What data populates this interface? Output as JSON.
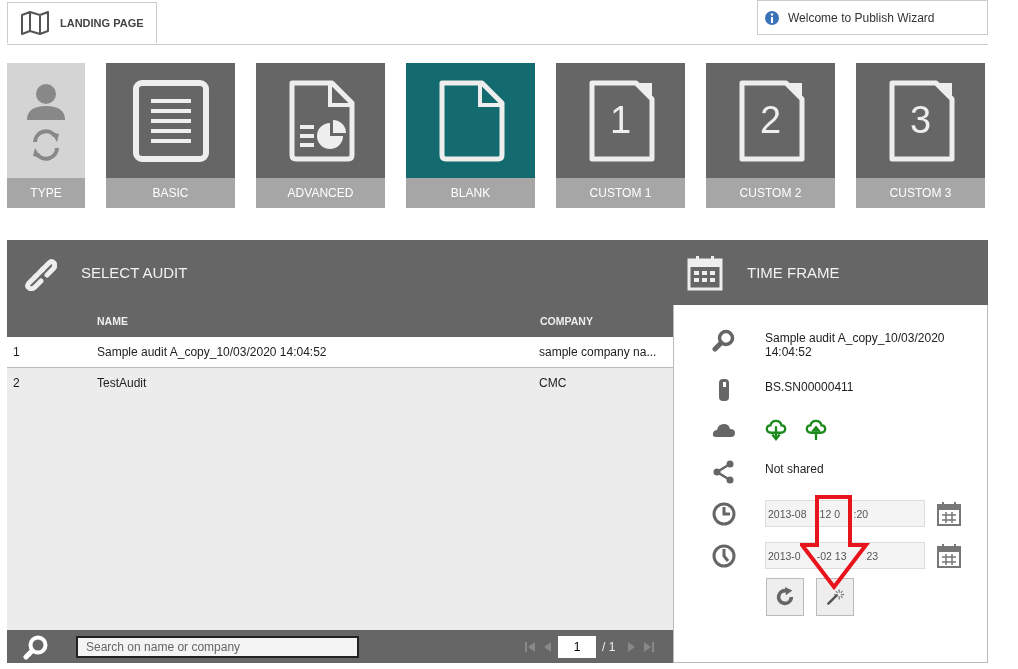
{
  "header": {
    "tab": {
      "label": "LANDING PAGE",
      "selected": true
    },
    "welcome": "Welcome to Publish Wizard"
  },
  "tiles": [
    {
      "kind": "type",
      "label": "TYPE",
      "selected": false
    },
    {
      "kind": "template",
      "label": "BASIC",
      "selected": false
    },
    {
      "kind": "template",
      "label": "ADVANCED",
      "selected": false
    },
    {
      "kind": "template",
      "label": "BLANK",
      "selected": true
    },
    {
      "kind": "numbered",
      "label": "CUSTOM 1",
      "number": "1",
      "selected": false
    },
    {
      "kind": "numbered",
      "label": "CUSTOM 2",
      "number": "2",
      "selected": false
    },
    {
      "kind": "numbered",
      "label": "CUSTOM 3",
      "number": "3",
      "selected": false
    }
  ],
  "audit": {
    "title": "SELECT AUDIT",
    "columns": [
      "NAME",
      "COMPANY"
    ],
    "rows": [
      {
        "index": "1",
        "name": "Sample audit A_copy_10/03/2020 14:04:52",
        "company": "sample company na...",
        "selected": true
      },
      {
        "index": "2",
        "name": "TestAudit",
        "company": "CMC",
        "selected": false
      }
    ],
    "search": {
      "placeholder": "Search on name or company"
    },
    "pager": {
      "page": "1",
      "total": "/ 1"
    }
  },
  "time_frame": {
    "title": "TIME FRAME",
    "details": [
      {
        "kind": "text",
        "text": "Sample audit A_copy_10/03/2020 14:04:52"
      },
      {
        "kind": "text",
        "text": "BS.SN00000411"
      },
      {
        "kind": "clouds"
      },
      {
        "kind": "text",
        "text": "Not shared"
      },
      {
        "kind": "date",
        "value_parts": [
          "2013-08",
          "12 0",
          ":20"
        ]
      },
      {
        "kind": "date",
        "value_parts": [
          "2013-0",
          "-02 13",
          "23"
        ]
      }
    ]
  }
}
